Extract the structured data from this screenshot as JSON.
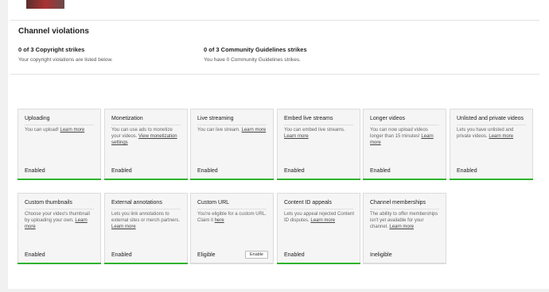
{
  "violations": {
    "title": "Channel violations",
    "copyright": {
      "title": "0 of 3 Copyright strikes",
      "subtitle": "Your copyright violations are listed below."
    },
    "community": {
      "title": "0 of 3 Community Guidelines strikes",
      "subtitle": "You have 0 Community Guidelines strikes."
    }
  },
  "features": [
    {
      "title": "Uploading",
      "desc": "You can upload!",
      "link": "Learn more",
      "status": "Enabled",
      "bar_color": "#2fb32f"
    },
    {
      "title": "Monetization",
      "desc": "You can use ads to monetize your videos.",
      "link": "View monetization settings",
      "status": "Enabled",
      "bar_color": "#2fb32f"
    },
    {
      "title": "Live streaming",
      "desc": "You can live stream.",
      "link": "Learn more",
      "status": "Enabled",
      "bar_color": "#2fb32f"
    },
    {
      "title": "Embed live streams",
      "desc": "You can embed live streams.",
      "link": "Learn more",
      "status": "Enabled",
      "bar_color": "#2fb32f"
    },
    {
      "title": "Longer videos",
      "desc": "You can now upload videos longer than 15 minutes!",
      "link": "Learn more",
      "status": "Enabled",
      "bar_color": "#2fb32f"
    },
    {
      "title": "Unlisted and private videos",
      "desc": "Lets you have unlisted and private videos.",
      "link": "Learn more",
      "status": "Enabled",
      "bar_color": "#2fb32f"
    },
    {
      "title": "Custom thumbnails",
      "desc": "Choose your video's thumbnail by uploading your own.",
      "link": "Learn more",
      "status": "Enabled",
      "bar_color": "#2fb32f"
    },
    {
      "title": "External annotations",
      "desc": "Lets you link annotations to external sites or merch partners.",
      "link": "Learn more",
      "status": "Enabled",
      "bar_color": "#2fb32f"
    },
    {
      "title": "Custom URL",
      "desc": "You're eligible for a custom URL. Claim it",
      "link": "here",
      "status": "Eligible",
      "button": "Enable",
      "bar_color": "#dcdcdc"
    },
    {
      "title": "Content ID appeals",
      "desc": "Lets you appeal rejected Content ID disputes.",
      "link": "Learn more",
      "status": "Enabled",
      "bar_color": "#2fb32f"
    },
    {
      "title": "Channel memberships",
      "desc": "The ability to offer memberships isn't yet available for your channel.",
      "link": "Learn more",
      "status": "Ineligible",
      "bar_color": "#dcdcdc"
    }
  ]
}
